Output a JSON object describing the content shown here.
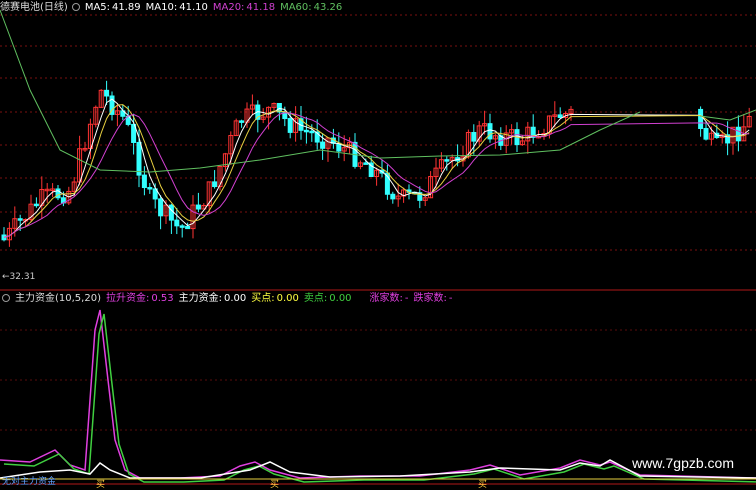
{
  "main_panel": {
    "title": "德赛电池(日线)",
    "ma5": {
      "label": "MA5:",
      "value": "41.89",
      "color": "#ffffff"
    },
    "ma10": {
      "label": "MA10:",
      "value": "41.10",
      "color": "#ffffff"
    },
    "ma20": {
      "label": "MA20:",
      "value": "41.18",
      "color": "#d040d0"
    },
    "ma60": {
      "label": "MA60:",
      "value": "43.26",
      "color": "#60c060"
    },
    "low_marker": "←32.31"
  },
  "indicator_panel": {
    "title": "主力资金(10,5,20)",
    "lift_label": "拉升资金:",
    "lift_value": "0.53",
    "main_label": "主力资金:",
    "main_value": "0.00",
    "buy_label": "买点:",
    "buy_value": "0.00",
    "sell_label": "卖点:",
    "sell_value": "0.00",
    "dragon_label": "涨家数:",
    "dragon_value": "-",
    "fall_label": "跌家数:",
    "fall_value": "-",
    "bottom_left_text": "无对主力资金",
    "bottom_marks": [
      "买",
      "买",
      "买"
    ]
  },
  "watermark": "www.7gpzb.com",
  "colors": {
    "up": "#ff3333",
    "down": "#33ffff",
    "ma20": "#d040d0",
    "ma60": "#60c060",
    "lift": "#e040e0",
    "main": "#40d040"
  }
}
